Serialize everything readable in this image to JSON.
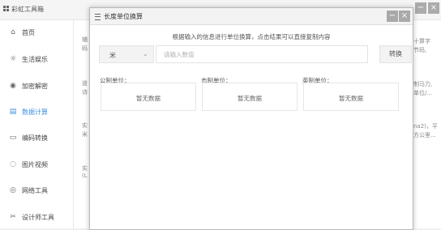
{
  "app": {
    "title": "彩虹工具箱",
    "controls": [
      "−",
      "×"
    ]
  },
  "sidebar": {
    "items": [
      {
        "label": "首页",
        "icon": "home-icon",
        "glyph": "⌂"
      },
      {
        "label": "生活娱乐",
        "icon": "life-icon",
        "glyph": "☼"
      },
      {
        "label": "加密解密",
        "icon": "lock-icon",
        "glyph": "◉"
      },
      {
        "label": "数据计算",
        "icon": "calc-icon",
        "glyph": "▤",
        "active": true
      },
      {
        "label": "编码转换",
        "icon": "code-icon",
        "glyph": "▭"
      },
      {
        "label": "图片视频",
        "icon": "image-icon",
        "glyph": "◌"
      },
      {
        "label": "网络工具",
        "icon": "network-icon",
        "glyph": "◎"
      },
      {
        "label": "设计师工具",
        "icon": "design-icon",
        "glyph": "✂"
      }
    ]
  },
  "background": {
    "left_snippets": [
      "辅",
      "码",
      "道",
      "诗",
      "实",
      "米",
      "实",
      "(L"
    ],
    "right_snippets": [
      "十算字",
      "节码,",
      "制马力,",
      "单位/...",
      "na2)，平",
      "方公里..."
    ]
  },
  "modal": {
    "title": "长度单位换算",
    "minimize": "−",
    "close": "×",
    "hint": "根据输入的信息进行单位换算，点击结果可以直接复制内容",
    "unit_select": {
      "value": "米"
    },
    "input": {
      "placeholder": "请输入数值",
      "value": ""
    },
    "convert_label": "转换",
    "groups": [
      {
        "label": "公制单位：",
        "result": "暂无数据"
      },
      {
        "label": "市制单位：",
        "result": "暂无数据"
      },
      {
        "label": "英制单位：",
        "result": "暂无数据"
      }
    ]
  }
}
